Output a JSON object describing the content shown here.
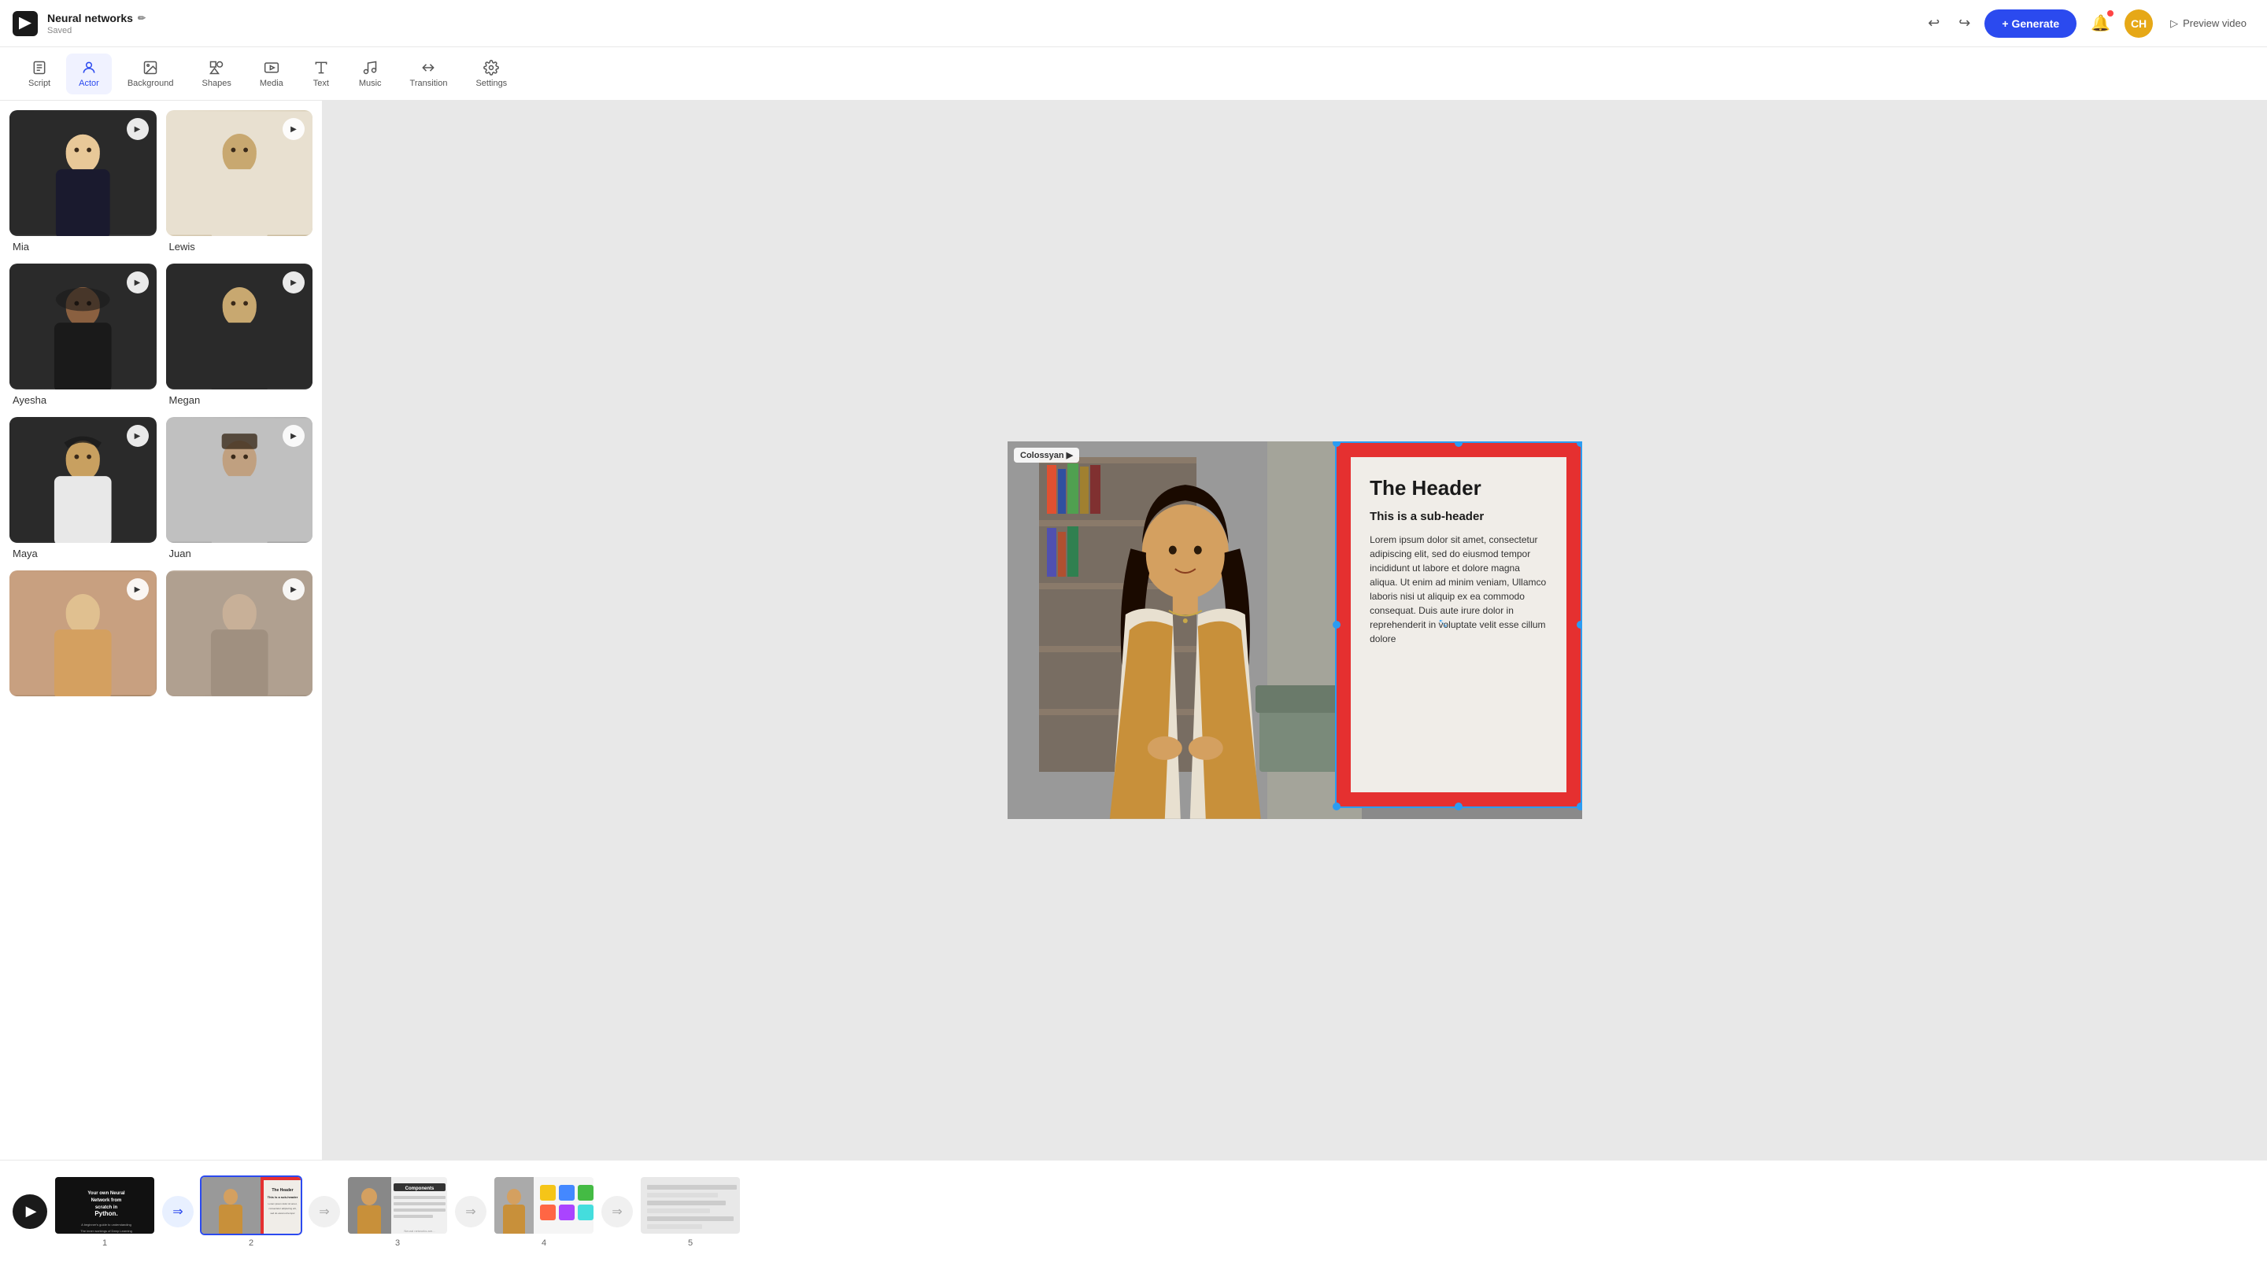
{
  "app": {
    "logo_alt": "Colossyan logo",
    "project_name": "Neural networks",
    "project_status": "Saved",
    "edit_label": "✏"
  },
  "topbar": {
    "undo_label": "↩",
    "redo_label": "↪",
    "generate_label": "+ Generate",
    "notification_label": "🔔",
    "avatar_label": "CH",
    "preview_label": "▷ Preview video"
  },
  "toolbar": {
    "items": [
      {
        "id": "script",
        "label": "Script",
        "icon": "script"
      },
      {
        "id": "actor",
        "label": "Actor",
        "icon": "actor",
        "active": true
      },
      {
        "id": "background",
        "label": "Background",
        "icon": "background"
      },
      {
        "id": "shapes",
        "label": "Shapes",
        "icon": "shapes"
      },
      {
        "id": "media",
        "label": "Media",
        "icon": "media"
      },
      {
        "id": "text",
        "label": "Text",
        "icon": "text"
      },
      {
        "id": "music",
        "label": "Music",
        "icon": "music"
      },
      {
        "id": "transition",
        "label": "Transition",
        "icon": "transition"
      },
      {
        "id": "settings",
        "label": "Settings",
        "icon": "settings"
      }
    ]
  },
  "sidebar": {
    "actors": [
      {
        "name": "Mia",
        "color": "actor-mia"
      },
      {
        "name": "Lewis",
        "color": "actor-lewis"
      },
      {
        "name": "Ayesha",
        "color": "actor-ayesha"
      },
      {
        "name": "Megan",
        "color": "actor-megan"
      },
      {
        "name": "Maya",
        "color": "actor-maya"
      },
      {
        "name": "Juan",
        "color": "actor-juan"
      },
      {
        "name": "",
        "color": "actor-extra"
      },
      {
        "name": "",
        "color": "actor-extra2"
      }
    ]
  },
  "canvas": {
    "colossyan_label": "Colossyan ▶",
    "slide_header": "The Header",
    "slide_subheader": "This is a sub-header",
    "slide_body": "Lorem ipsum dolor sit amet, consectetur adipiscing elit, sed do eiusmod tempor incididunt ut labore et dolore magna aliqua. Ut enim ad minim veniam, Ullamco laboris nisi ut aliquip ex ea commodo consequat. Duis aute irure dolor in reprehenderit in voluptate velit esse cillum dolore"
  },
  "timeline": {
    "slides": [
      {
        "num": "1",
        "active": false
      },
      {
        "num": "2",
        "active": true
      },
      {
        "num": "3",
        "active": false
      },
      {
        "num": "4",
        "active": false
      },
      {
        "num": "5",
        "active": false
      }
    ]
  }
}
